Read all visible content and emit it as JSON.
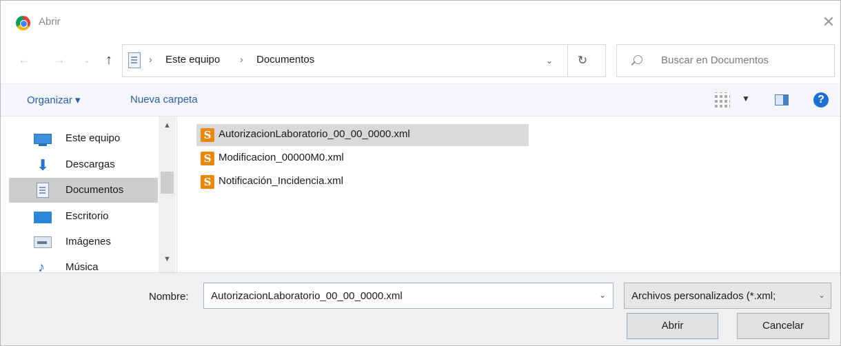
{
  "window": {
    "title": "Abrir"
  },
  "address_bar": {
    "breadcrumbs": [
      "Este equipo",
      "Documentos"
    ],
    "separator": "›"
  },
  "search": {
    "placeholder": "Buscar en Documentos"
  },
  "toolbar": {
    "organize_label": "Organizar ▾",
    "new_folder_label": "Nueva carpeta"
  },
  "nav_pane": {
    "items": [
      {
        "label": "Este equipo",
        "icon": "computer-icon"
      },
      {
        "label": "Descargas",
        "icon": "downloads-icon"
      },
      {
        "label": "Documentos",
        "icon": "documents-icon",
        "selected": true
      },
      {
        "label": "Escritorio",
        "icon": "desktop-icon"
      },
      {
        "label": "Imágenes",
        "icon": "images-icon"
      },
      {
        "label": "Música",
        "icon": "music-icon"
      }
    ]
  },
  "files": [
    {
      "name": "AutorizacionLaboratorio_00_00_0000.xml",
      "icon": "sublime-file-icon",
      "selected": true
    },
    {
      "name": "Modificacion_00000M0.xml",
      "icon": "sublime-file-icon"
    },
    {
      "name": "Notificación_Incidencia.xml",
      "icon": "sublime-file-icon"
    }
  ],
  "footer": {
    "name_label": "Nombre:",
    "name_value": "AutorizacionLaboratorio_00_00_0000.xml",
    "filter_value": "Archivos personalizados (*.xml;",
    "open_label": "Abrir",
    "cancel_label": "Cancelar"
  },
  "colors": {
    "link_blue": "#2b5aa8",
    "selection_gray": "#d9d9d9",
    "file_icon_orange": "#e8890c",
    "help_blue": "#1f6fd1"
  }
}
